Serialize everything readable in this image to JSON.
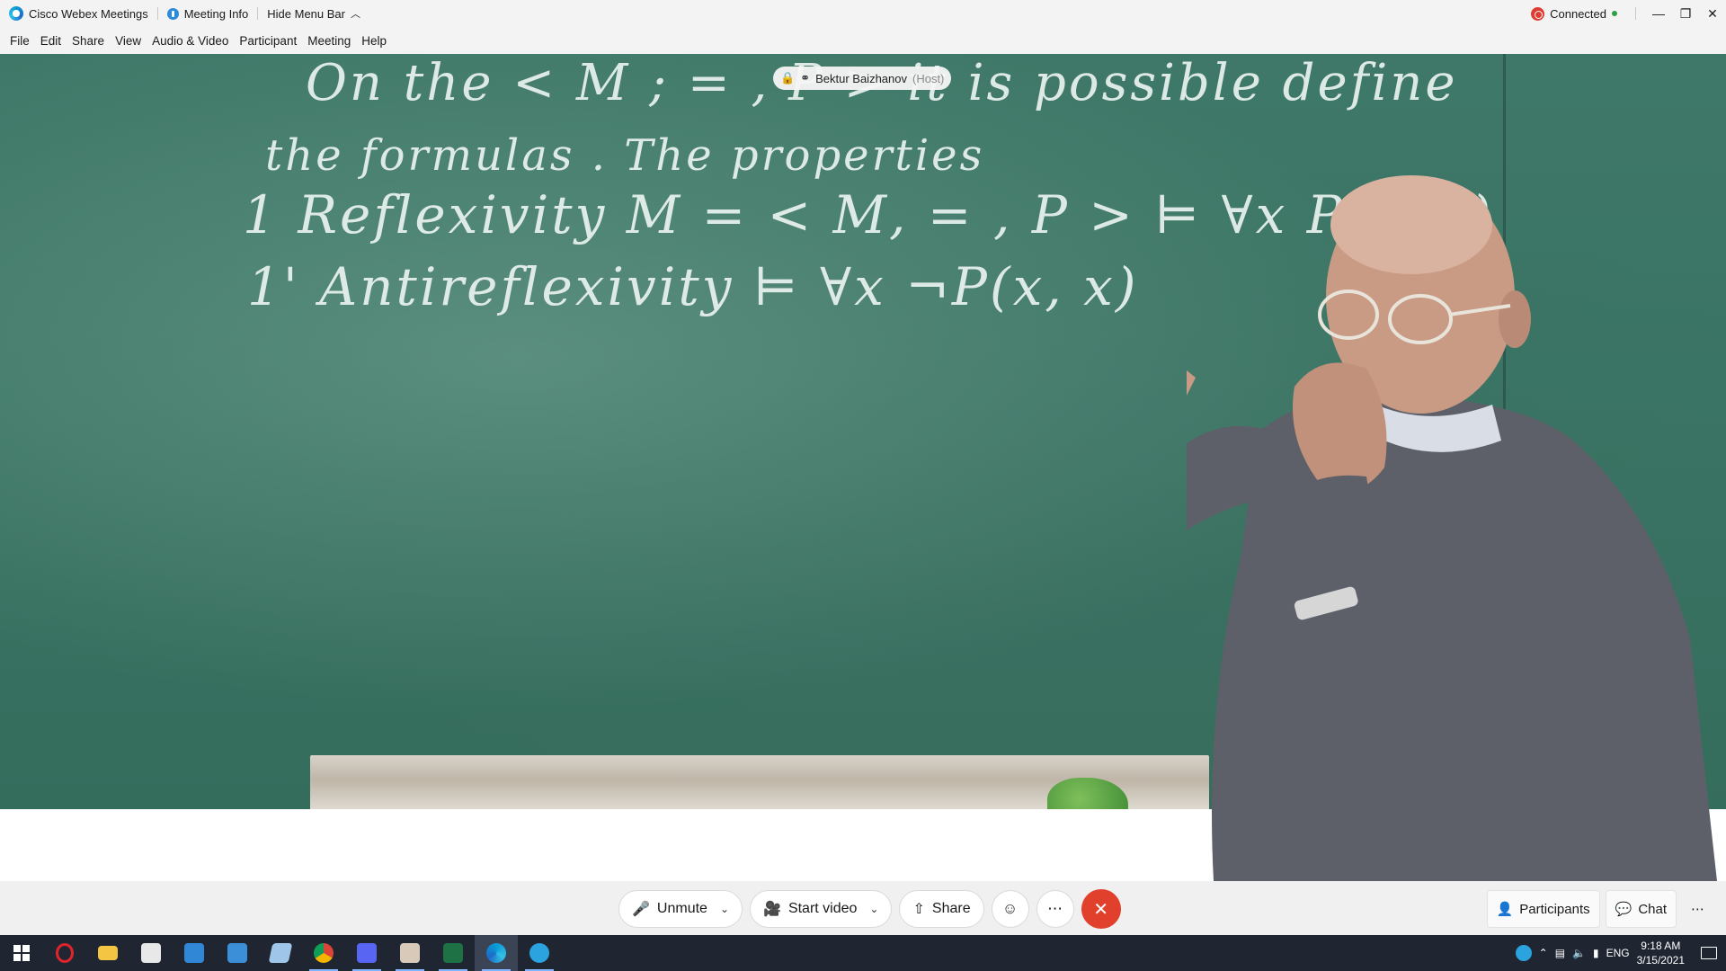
{
  "titlebar": {
    "app_name": "Cisco Webex Meetings",
    "meeting_info": "Meeting Info",
    "hide_menu_bar": "Hide Menu Bar",
    "status": "Connected"
  },
  "menu": {
    "items": [
      "File",
      "Edit",
      "Share",
      "View",
      "Audio & Video",
      "Participant",
      "Meeting",
      "Help"
    ]
  },
  "video": {
    "host_name": "Bektur Baizhanov",
    "host_role": "(Host)",
    "chalk": {
      "line1": "On the < M ; = , P > it is possible define",
      "line2": "the formulas . The properties",
      "line3": "1 Reflexivity  M = < M, = , P > ⊨ ∀x P(x, x)",
      "line4": "1' Antireflexivity ⊨ ∀x ¬P(x, x)"
    }
  },
  "controls": {
    "unmute": "Unmute",
    "start_video": "Start video",
    "share": "Share",
    "participants": "Participants",
    "chat": "Chat"
  },
  "taskbar": {
    "language": "ENG",
    "time": "9:18 AM",
    "date": "3/15/2021"
  }
}
